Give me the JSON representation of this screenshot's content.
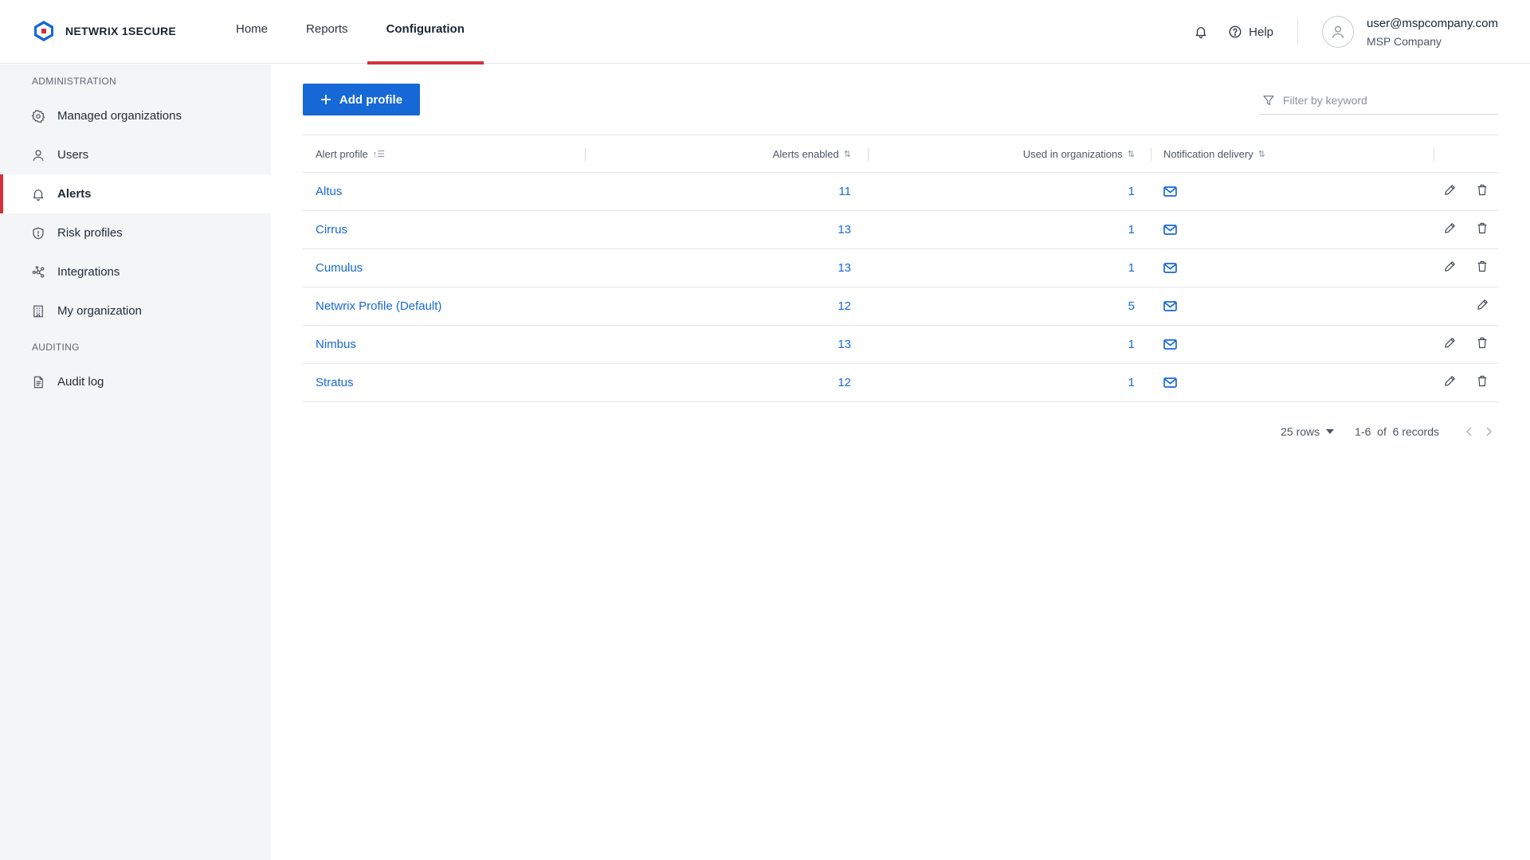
{
  "app": {
    "logo_text": "NETWRIX 1SECURE"
  },
  "nav": {
    "tabs": [
      {
        "label": "Home"
      },
      {
        "label": "Reports"
      },
      {
        "label": "Configuration"
      }
    ]
  },
  "header": {
    "help_label": "Help",
    "user_email": "user@mspcompany.com",
    "user_company": "MSP Company"
  },
  "sidebar": {
    "admin_label": "ADMINISTRATION",
    "audit_label": "AUDITING",
    "items": [
      {
        "label": "Managed organizations",
        "icon": "gear-icon"
      },
      {
        "label": "Users",
        "icon": "user-icon"
      },
      {
        "label": "Alerts",
        "icon": "bell-icon",
        "active": true
      },
      {
        "label": "Risk profiles",
        "icon": "shield-icon"
      },
      {
        "label": "Integrations",
        "icon": "network-icon"
      },
      {
        "label": "My organization",
        "icon": "building-icon"
      },
      {
        "label": "Audit log",
        "icon": "document-icon"
      }
    ]
  },
  "toolbar": {
    "add_label": "Add profile",
    "filter_placeholder": "Filter by keyword"
  },
  "table": {
    "headers": {
      "profile": "Alert profile",
      "alerts": "Alerts enabled",
      "used": "Used in organizations",
      "notification": "Notification delivery"
    },
    "rows": [
      {
        "name": "Altus",
        "alerts": "11",
        "used": "1",
        "deletable": true
      },
      {
        "name": "Cirrus",
        "alerts": "13",
        "used": "1",
        "deletable": true
      },
      {
        "name": "Cumulus",
        "alerts": "13",
        "used": "1",
        "deletable": true
      },
      {
        "name": "Netwrix Profile (Default)",
        "alerts": "12",
        "used": "5",
        "deletable": false
      },
      {
        "name": "Nimbus",
        "alerts": "13",
        "used": "1",
        "deletable": true
      },
      {
        "name": "Stratus",
        "alerts": "12",
        "used": "1",
        "deletable": true
      }
    ]
  },
  "pager": {
    "rows_label": "25 rows",
    "range": "1-6",
    "of_label": "of",
    "total": "6 records"
  },
  "colors": {
    "accent": "#1668d6",
    "active_marker": "#d3303b",
    "sidebar_bg": "#f4f5f6"
  }
}
